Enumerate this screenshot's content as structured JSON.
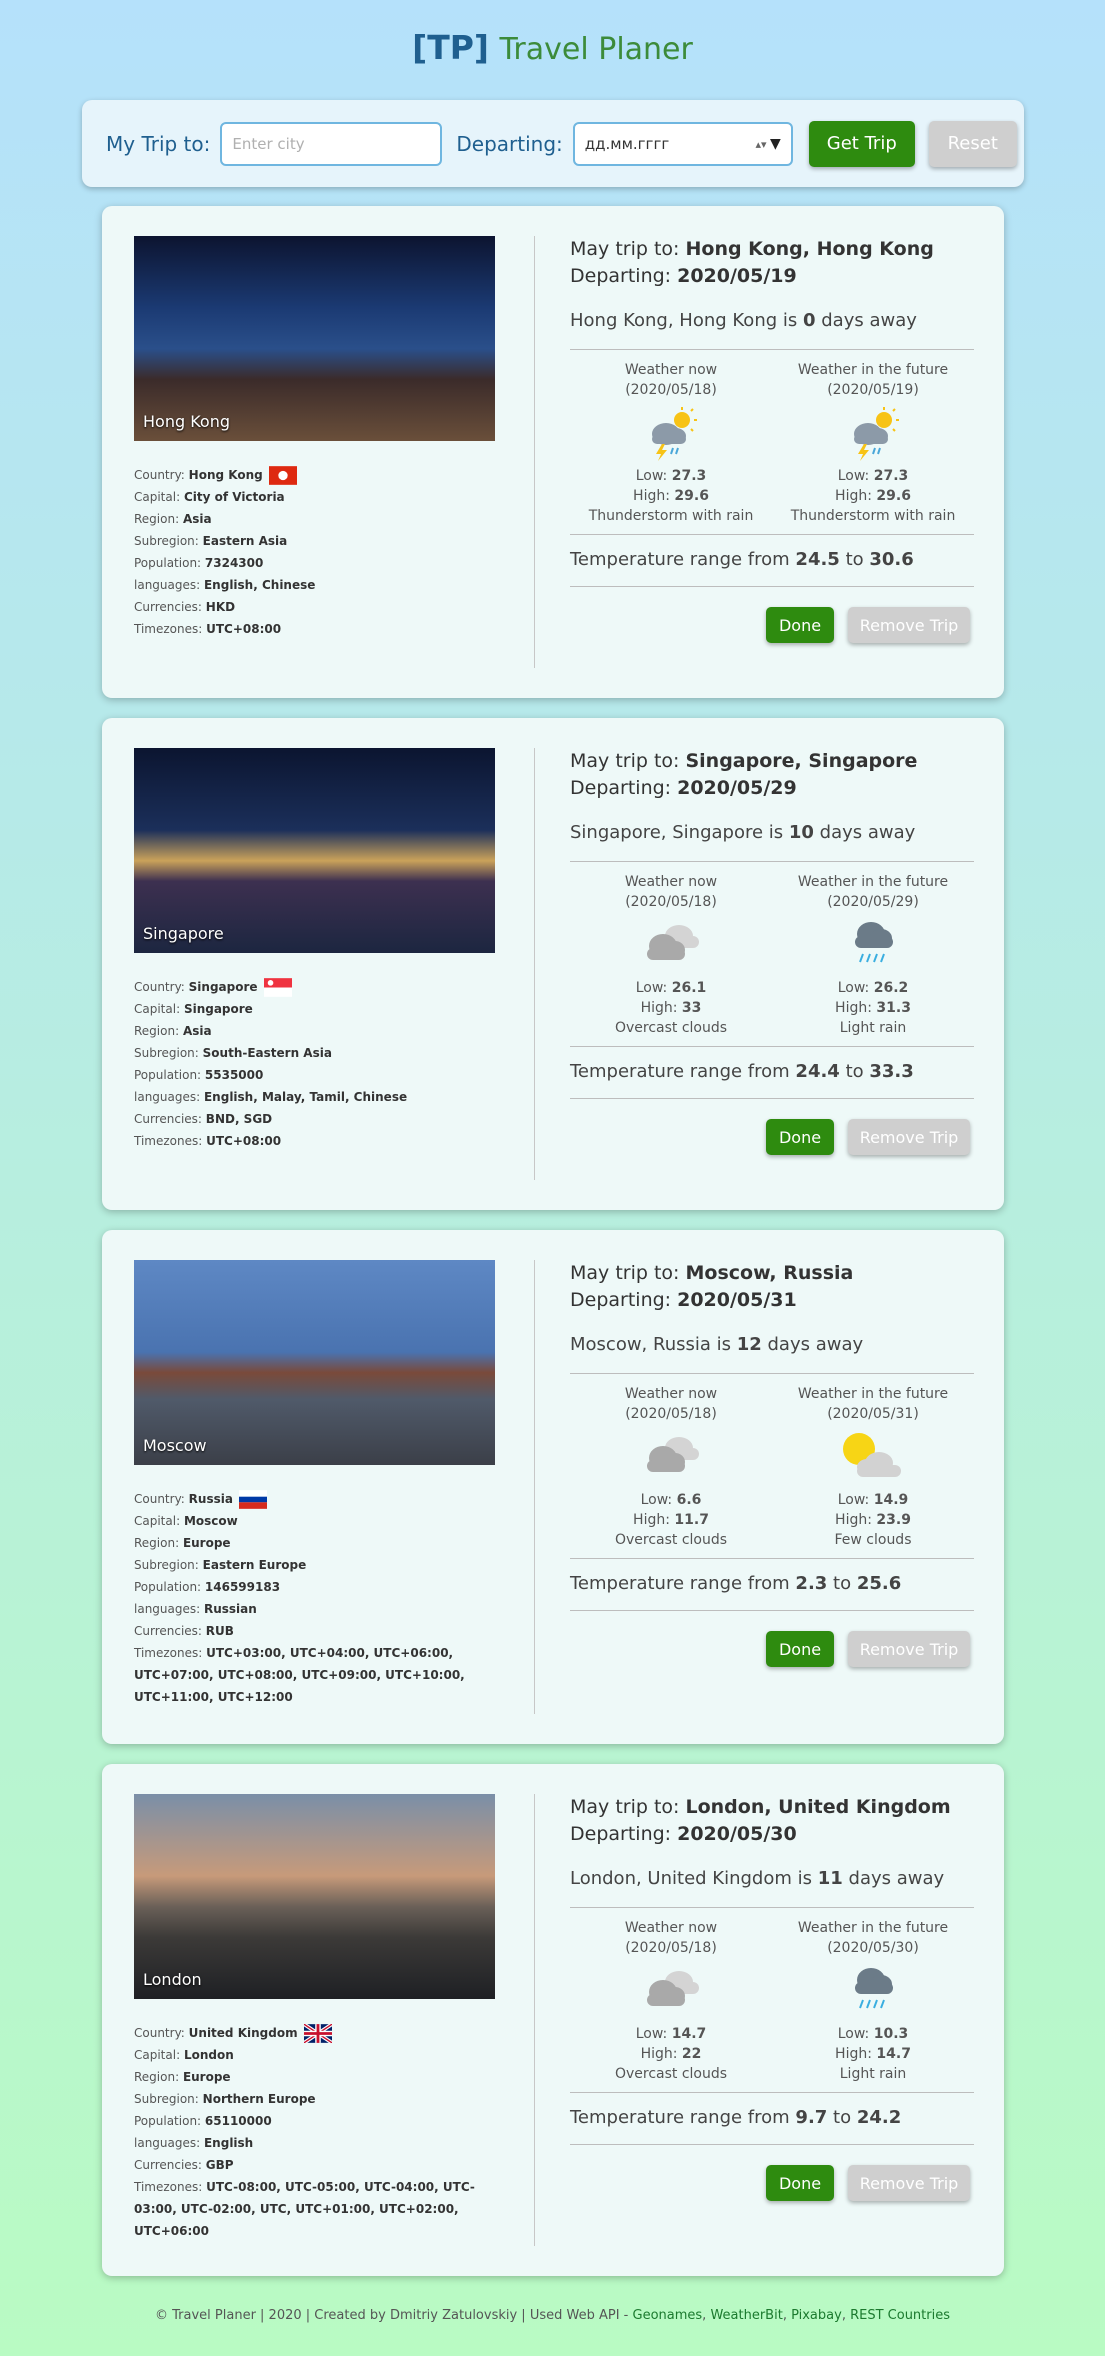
{
  "header": {
    "logo_tp": "[TP]",
    "logo_name": "Travel Planer"
  },
  "search": {
    "trip_label": "My Trip to:",
    "city_placeholder": "Enter city",
    "departing_label": "Departing:",
    "date_placeholder": "дд.мм.гггг",
    "get_button": "Get Trip",
    "reset_button": "Reset"
  },
  "labels": {
    "trip_prefix": "May trip to: ",
    "departing_prefix": "Departing: ",
    "is": " is ",
    "days_away": " days away",
    "weather_now": "Weather now",
    "weather_future": "Weather in the future",
    "low": "Low: ",
    "high": "High: ",
    "range_prefix": "Temperature range from ",
    "range_to": " to ",
    "country": "Country: ",
    "capital": "Capital: ",
    "region": "Region: ",
    "subregion": "Subregion: ",
    "population": "Population: ",
    "languages": "languages: ",
    "currencies": "Currencies: ",
    "timezones": "Timezones: ",
    "done": "Done",
    "remove": "Remove Trip"
  },
  "trips": [
    {
      "photo_label": "Hong Kong",
      "country": "Hong Kong",
      "capital": "City of Victoria",
      "region": "Asia",
      "subregion": "Eastern Asia",
      "population": "7324300",
      "languages": "English, Chinese",
      "currencies": "HKD",
      "timezones": "UTC+08:00",
      "destination": "Hong Kong, Hong Kong",
      "departing": "2020/05/19",
      "days": "0",
      "now_date": "(2020/05/18)",
      "now_icon": "thunderstorm-icon",
      "now_low": "27.3",
      "now_high": "29.6",
      "now_desc": "Thunderstorm with rain",
      "fut_date": "(2020/05/19)",
      "fut_icon": "thunderstorm-icon",
      "fut_low": "27.3",
      "fut_high": "29.6",
      "fut_desc": "Thunderstorm with rain",
      "range_low": "24.5",
      "range_high": "30.6"
    },
    {
      "photo_label": "Singapore",
      "country": "Singapore",
      "capital": "Singapore",
      "region": "Asia",
      "subregion": "South-Eastern Asia",
      "population": "5535000",
      "languages": "English, Malay, Tamil, Chinese",
      "currencies": "BND, SGD",
      "timezones": "UTC+08:00",
      "destination": "Singapore, Singapore",
      "departing": "2020/05/29",
      "days": "10",
      "now_date": "(2020/05/18)",
      "now_icon": "overcast-clouds-icon",
      "now_low": "26.1",
      "now_high": "33",
      "now_desc": "Overcast clouds",
      "fut_date": "(2020/05/29)",
      "fut_icon": "light-rain-icon",
      "fut_low": "26.2",
      "fut_high": "31.3",
      "fut_desc": "Light rain",
      "range_low": "24.4",
      "range_high": "33.3"
    },
    {
      "photo_label": "Moscow",
      "country": "Russia",
      "capital": "Moscow",
      "region": "Europe",
      "subregion": "Eastern Europe",
      "population": "146599183",
      "languages": "Russian",
      "currencies": "RUB",
      "timezones": "UTC+03:00, UTC+04:00, UTC+06:00, UTC+07:00, UTC+08:00, UTC+09:00, UTC+10:00, UTC+11:00, UTC+12:00",
      "destination": "Moscow, Russia",
      "departing": "2020/05/31",
      "days": "12",
      "now_date": "(2020/05/18)",
      "now_icon": "overcast-clouds-icon",
      "now_low": "6.6",
      "now_high": "11.7",
      "now_desc": "Overcast clouds",
      "fut_date": "(2020/05/31)",
      "fut_icon": "few-clouds-icon",
      "fut_low": "14.9",
      "fut_high": "23.9",
      "fut_desc": "Few clouds",
      "range_low": "2.3",
      "range_high": "25.6"
    },
    {
      "photo_label": "London",
      "country": "United Kingdom",
      "capital": "London",
      "region": "Europe",
      "subregion": "Northern Europe",
      "population": "65110000",
      "languages": "English",
      "currencies": "GBP",
      "timezones": "UTC-08:00, UTC-05:00, UTC-04:00, UTC-03:00, UTC-02:00, UTC, UTC+01:00, UTC+02:00, UTC+06:00",
      "destination": "London, United Kingdom",
      "departing": "2020/05/30",
      "days": "11",
      "now_date": "(2020/05/18)",
      "now_icon": "overcast-clouds-icon",
      "now_low": "14.7",
      "now_high": "22",
      "now_desc": "Overcast clouds",
      "fut_date": "(2020/05/30)",
      "fut_icon": "light-rain-icon",
      "fut_low": "10.3",
      "fut_high": "14.7",
      "fut_desc": "Light rain",
      "range_low": "9.7",
      "range_high": "24.2"
    }
  ],
  "footer": {
    "text": "© Travel Planer | 2020 | Created by Dmitriy Zatulovskiy | Used Web API - ",
    "links": [
      "Geonames",
      ", ",
      "WeatherBit",
      ", ",
      "Pixabay",
      ", ",
      "REST Countries"
    ]
  },
  "colors": {
    "accent_green": "#2e8b0f",
    "accent_blue": "#1f5f8f",
    "disabled": "#cfcfcf"
  }
}
